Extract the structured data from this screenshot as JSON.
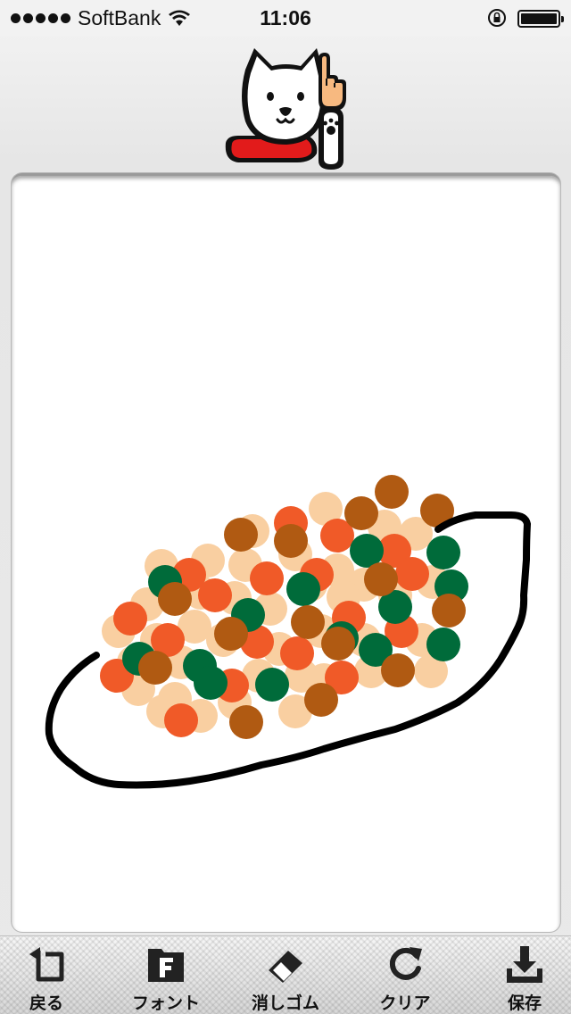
{
  "status_bar": {
    "carrier": "SoftBank",
    "time": "11:06",
    "signal_bars": 5,
    "icons": [
      "signal-dots-icon",
      "wifi-icon",
      "orientation-lock-icon",
      "battery-icon"
    ]
  },
  "header": {
    "mascot_icon": "white-dog-mascot-icon"
  },
  "canvas": {
    "ink_color": "#000000",
    "dot_colors": {
      "peach": "#f9cfa1",
      "orange": "#f05a28",
      "brown": "#b05a12",
      "green": "#006b3a"
    }
  },
  "toolbar": {
    "items": [
      {
        "label": "戻る",
        "icon": "undo-icon"
      },
      {
        "label": "フォント",
        "icon": "font-icon"
      },
      {
        "label": "消しゴム",
        "icon": "eraser-icon"
      },
      {
        "label": "クリア",
        "icon": "clear-icon"
      },
      {
        "label": "保存",
        "icon": "save-icon"
      }
    ]
  }
}
